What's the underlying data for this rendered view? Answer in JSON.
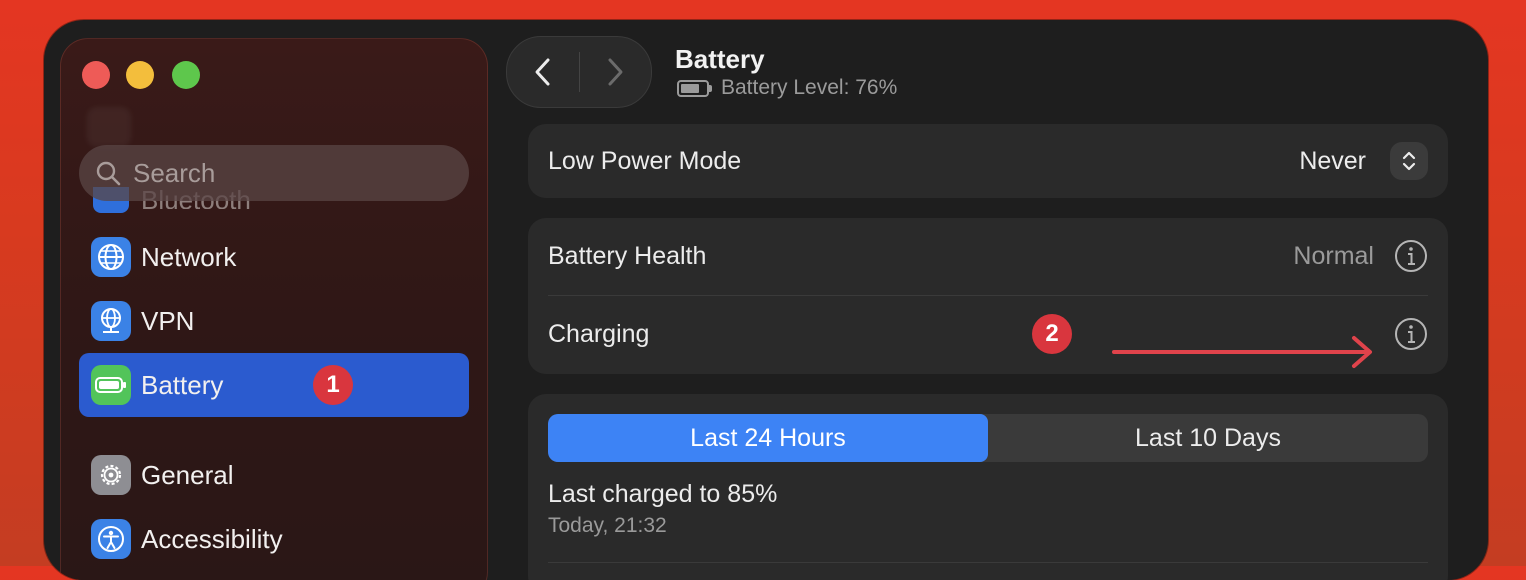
{
  "sidebar": {
    "search_placeholder": "Search",
    "partial_item": "Bluetooth",
    "items": [
      {
        "label": "Network",
        "icon": "globe-icon"
      },
      {
        "label": "VPN",
        "icon": "vpn-globe-icon"
      },
      {
        "label": "Battery",
        "icon": "battery-icon"
      },
      {
        "label": "General",
        "icon": "gear-icon"
      },
      {
        "label": "Accessibility",
        "icon": "accessibility-icon"
      }
    ],
    "selected": "Battery"
  },
  "annotations": {
    "badge1": "1",
    "badge2": "2"
  },
  "header": {
    "title": "Battery",
    "subtitle": "Battery Level: 76%",
    "battery_level": 0.76
  },
  "low_power": {
    "label": "Low Power Mode",
    "value": "Never"
  },
  "health": {
    "label": "Battery Health",
    "value": "Normal"
  },
  "charging": {
    "label": "Charging"
  },
  "usage": {
    "tabs": [
      "Last 24 Hours",
      "Last 10 Days"
    ],
    "active_tab": "Last 24 Hours",
    "last_charged": "Last charged to 85%",
    "last_charged_time": "Today, 21:32"
  },
  "colors": {
    "accent": "#3d83f5",
    "selection": "#2b5bcf",
    "badge": "#d9363e",
    "annotation_arrow": "#e0434b"
  }
}
